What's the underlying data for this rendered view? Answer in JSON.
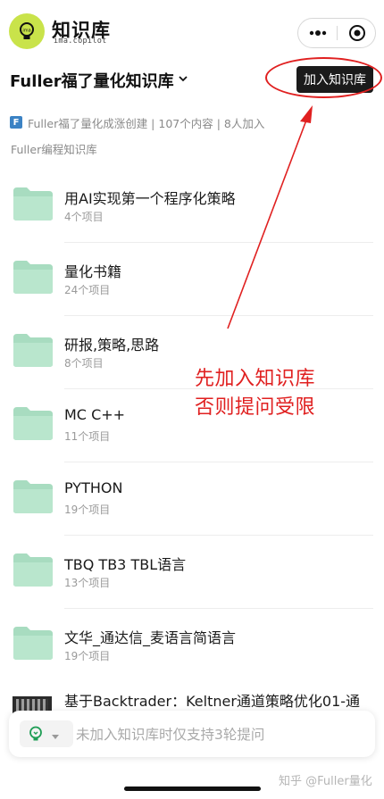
{
  "app": {
    "logo_title": "知识库",
    "logo_sub": "ima.copilot"
  },
  "knowledge_base": {
    "title": "Fuller福了量化知识库",
    "join_button": "加入知识库",
    "meta": "Fuller福了量化成涨创建 | 107个内容 | 8人加入",
    "subtitle": "Fuller编程知识库"
  },
  "folders": [
    {
      "name": "用AI实现第一个程序化策略",
      "count": "4个项目"
    },
    {
      "name": "量化书籍",
      "count": "24个项目"
    },
    {
      "name": "研报,策略,思路",
      "count": "8个项目"
    },
    {
      "name": "MC C++",
      "count": "11个项目"
    },
    {
      "name": "PYTHON",
      "count": "19个项目"
    },
    {
      "name": "TBQ TB3 TBL语言",
      "count": "13个项目"
    },
    {
      "name": "文华_通达信_麦语言简语言",
      "count": "19个项目"
    }
  ],
  "last_item": {
    "name": "基于Backtrader：Keltner通道策略优化01-通"
  },
  "ask": {
    "placeholder": "未加入知识库时仅支持3轮提问"
  },
  "annotation": {
    "line1": "先加入知识库",
    "line2": "否则提问受限"
  },
  "watermark": "知乎 @Fuller量化",
  "colors": {
    "folder": "#a8dcc0",
    "annotation_red": "#e02020",
    "logo_green": "#c9e34a"
  }
}
